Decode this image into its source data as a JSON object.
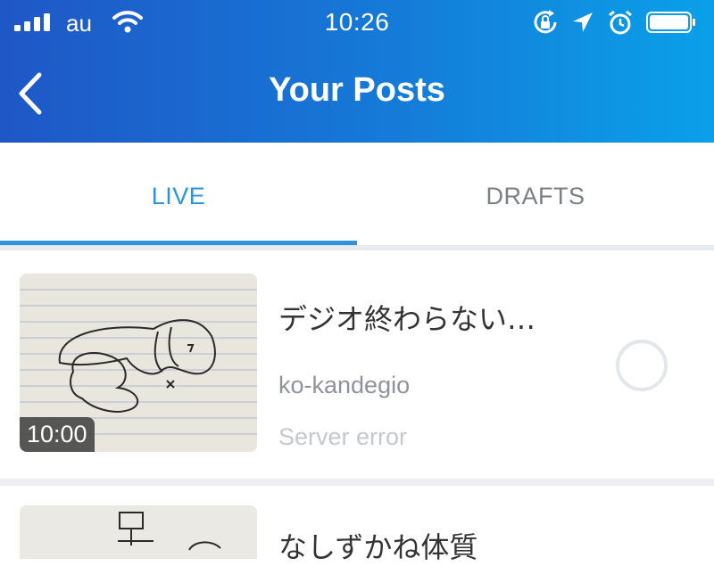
{
  "status_bar": {
    "carrier": "au",
    "time": "10:26",
    "icons": [
      "signal-icon",
      "wifi-icon",
      "rotation-lock-icon",
      "location-icon",
      "alarm-icon",
      "battery-icon"
    ]
  },
  "nav": {
    "title": "Your Posts",
    "back_icon": "chevron-left-icon"
  },
  "tabs": [
    {
      "label": "LIVE",
      "active": true
    },
    {
      "label": "DRAFTS",
      "active": false
    }
  ],
  "posts": [
    {
      "title": "デジオ終わらない…",
      "author": "ko-kandegio",
      "status": "Server error",
      "duration": "10:00"
    },
    {
      "title": "なしずかね体質"
    }
  ],
  "colors": {
    "header_start": "#1f57c6",
    "header_end": "#0aa0e8",
    "accent": "#2d93d9"
  }
}
